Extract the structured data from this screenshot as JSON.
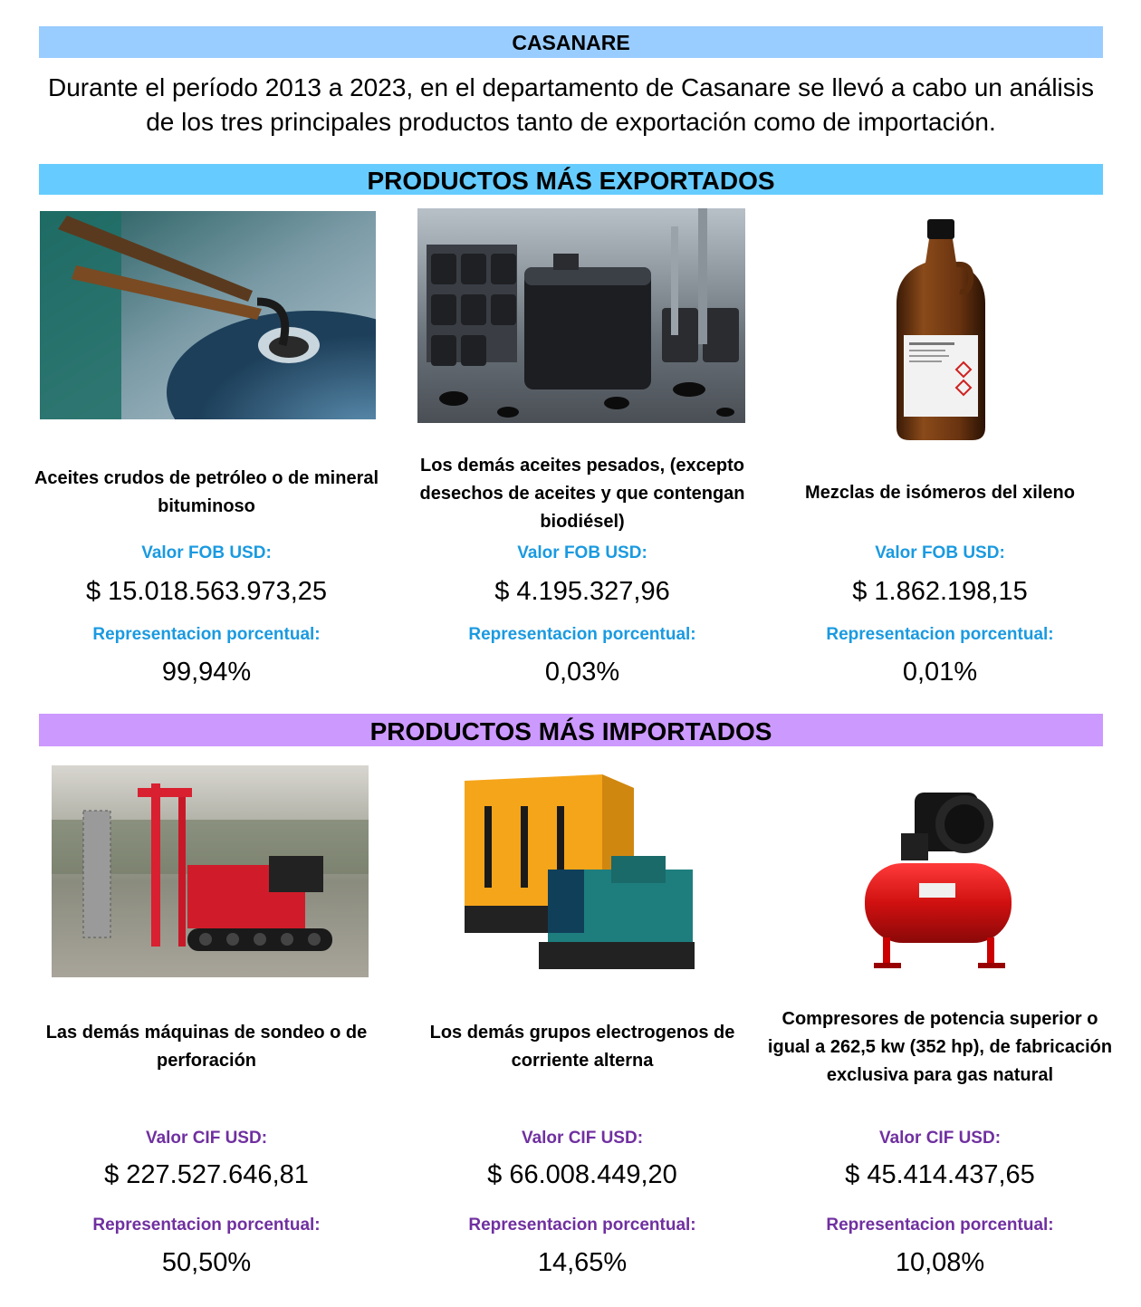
{
  "header": {
    "title": "CASANARE",
    "intro": "Durante el período 2013 a 2023, en el departamento de Casanare se llevó a cabo un análisis de los tres principales productos tanto de exportación como de importación."
  },
  "exports": {
    "title": "PRODUCTOS MÁS EXPORTADOS",
    "value_label": "Valor FOB USD:",
    "share_label": "Representacion porcentual:",
    "items": [
      {
        "name": "Aceites crudos de petróleo o de mineral bituminoso",
        "value": "$ 15.018.563.973,25",
        "share": "99,94%"
      },
      {
        "name": "Los demás aceites pesados, (excepto desechos de aceites  y que contengan biodiésel)",
        "value": "$ 4.195.327,96",
        "share": "0,03%"
      },
      {
        "name": "Mezclas de isómeros del xileno",
        "value": "$ 1.862.198,15",
        "share": "0,01%"
      }
    ]
  },
  "imports": {
    "title": "PRODUCTOS MÁS IMPORTADOS",
    "value_label": "Valor CIF USD:",
    "share_label": "Representacion porcentual:",
    "items": [
      {
        "name": "Las demás máquinas de sondeo o de perforación",
        "value": "$ 227.527.646,81",
        "share": "50,50%"
      },
      {
        "name": "Los demás grupos electrogenos de corriente alterna",
        "value": "$ 66.008.449,20",
        "share": "14,65%"
      },
      {
        "name": "Compresores  de potencia superior o igual  a 262,5 kw (352 hp), de fabricación exclusiva para gas natural",
        "value": "$ 45.414.437,65",
        "share": "10,08%"
      }
    ]
  }
}
